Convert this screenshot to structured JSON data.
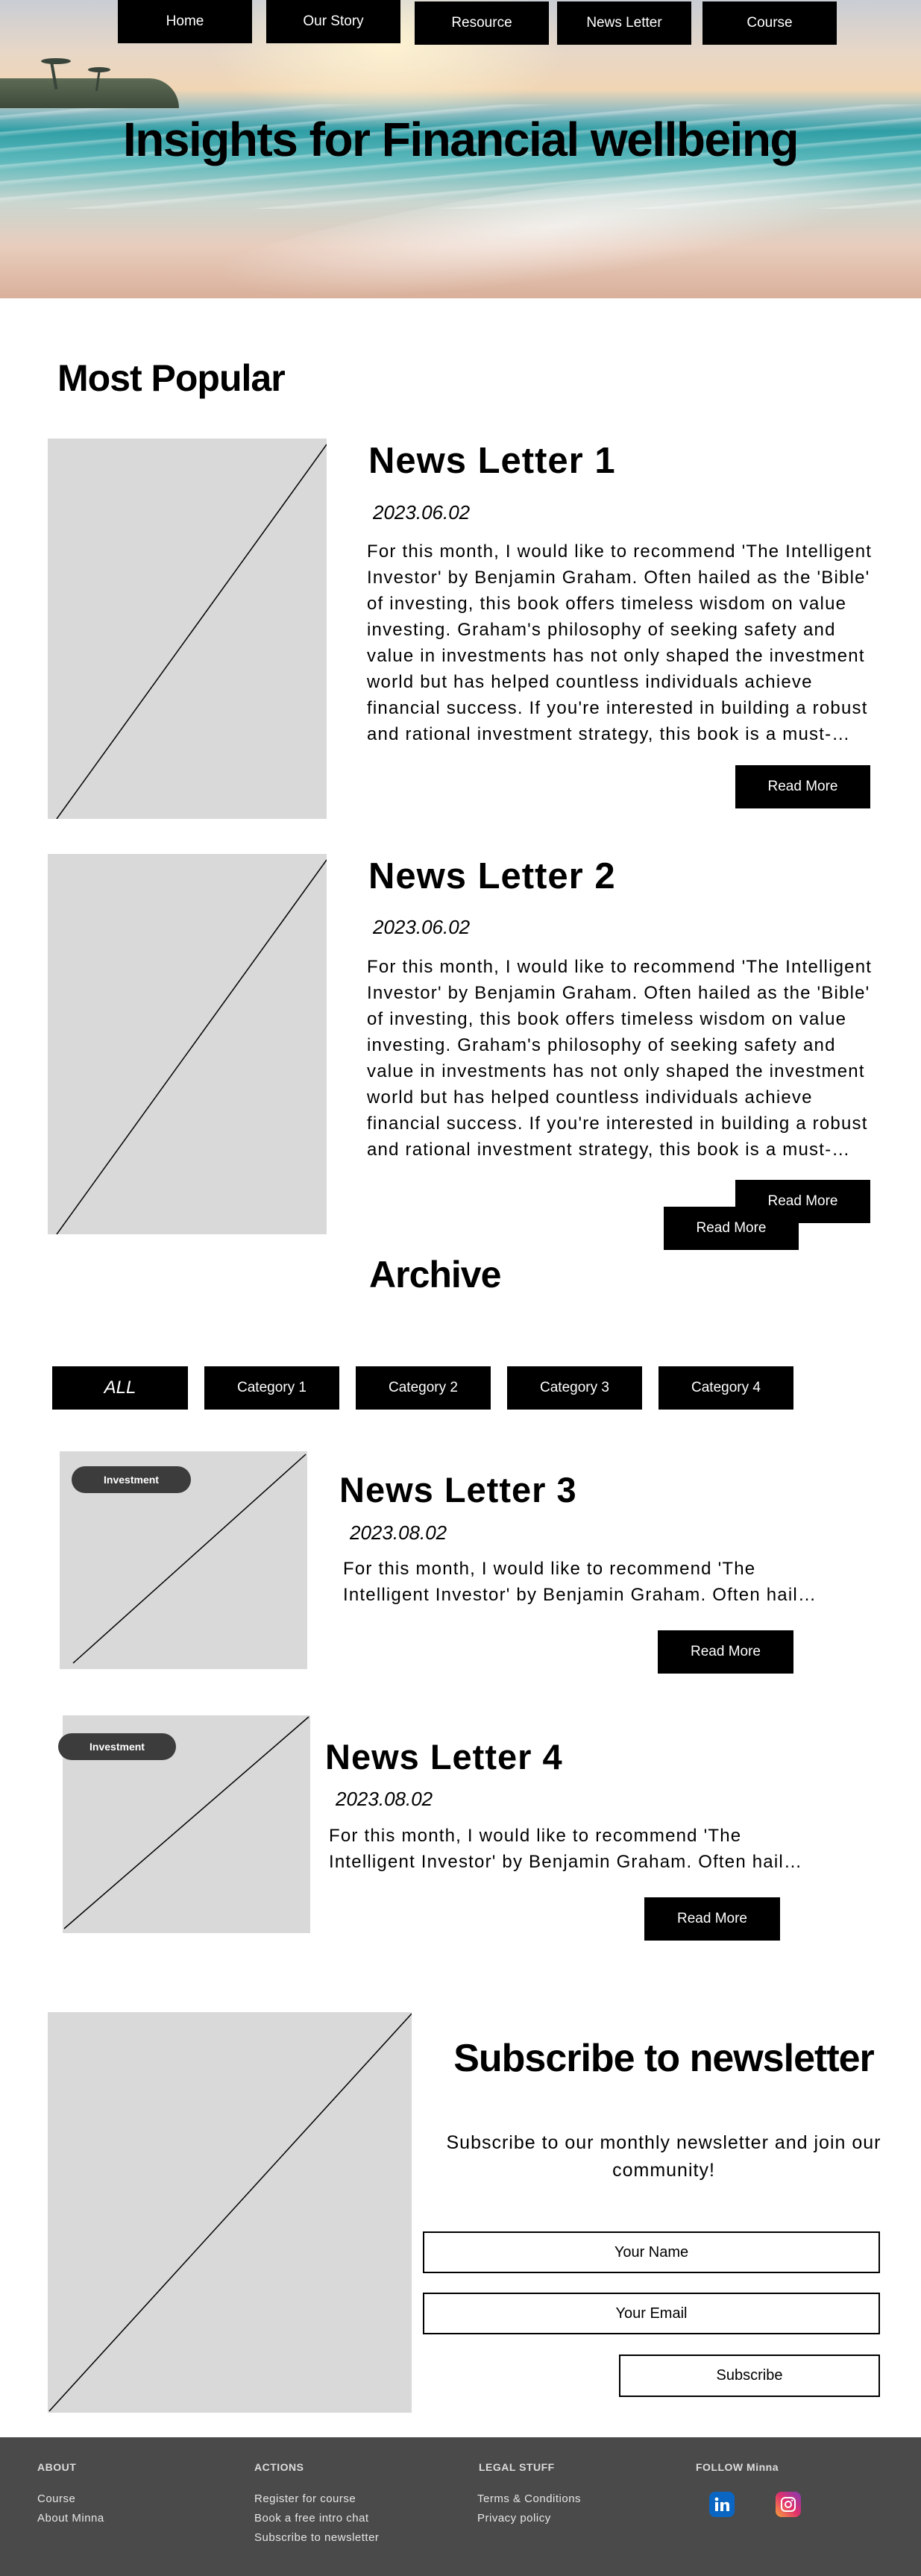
{
  "nav": [
    "Home",
    "Our Story",
    "Resource",
    "News Letter",
    "Course"
  ],
  "hero": {
    "title": "Insights for Financial wellbeing"
  },
  "popular": {
    "heading": "Most  Popular",
    "items": [
      {
        "title": "News Letter  1",
        "date": "2023.06.02",
        "body": "For this month, I would like to recommend 'The Intelligent Investor' by Benjamin Graham. Often hailed as the 'Bible' of investing, this book offers timeless wisdom on value investing. Graham's philosophy of seeking safety and value in investments has not only shaped the investment world but has helped countless individuals achieve financial success. If you're interested in building a robust and rational investment strategy, this book is a must-read.",
        "button": "Read More"
      },
      {
        "title": "News Letter  2",
        "date": "2023.06.02",
        "body": "For this month, I would like to recommend 'The Intelligent Investor' by Benjamin Graham. Often hailed as the 'Bible' of investing, this book offers timeless wisdom on value investing. Graham's philosophy of seeking safety and value in investments has not only shaped the investment world but has helped countless individuals achieve financial success. If you're interested in building a robust and rational investment strategy, this book is a must-read.",
        "button": "Read More",
        "button2": "Read More"
      }
    ]
  },
  "archive": {
    "heading": "Archive",
    "filters": [
      "ALL",
      "Category 1",
      "Category 2",
      "Category 3",
      "Category 4"
    ],
    "items": [
      {
        "tag": "Investment",
        "title": "News Letter  3",
        "date": "2023.08.02",
        "body": "For this month, I would like to recommend 'The Intelligent Investor' by Benjamin Graham. Often hailed as the 'Bible' of investing.",
        "button": "Read More"
      },
      {
        "tag": "Investment",
        "title": "News Letter  4",
        "date": "2023.08.02",
        "body": "For this month, I would like to recommend 'The Intelligent Investor' by Benjamin Graham. Often hailed as the 'Bible' of investing.",
        "button": "Read More"
      }
    ]
  },
  "subscribe": {
    "title": "Subscribe to newsletter",
    "text": "Subscribe to our monthly newsletter and join our community!",
    "name_placeholder": "Your Name",
    "email_placeholder": "Your Email",
    "button": "Subscribe"
  },
  "footer": {
    "about": {
      "heading": "ABOUT",
      "links": [
        "Course",
        "About Minna"
      ]
    },
    "actions": {
      "heading": "ACTIONS",
      "links": [
        "Register for course",
        "Book a free intro chat",
        "Subscribe to newsletter"
      ]
    },
    "legal": {
      "heading": "LEGAL STUFF",
      "links": [
        "Terms & Conditions",
        "Privacy policy"
      ]
    },
    "follow": {
      "heading": "FOLLOW Minna",
      "icons": [
        "linkedin-icon",
        "instagram-icon"
      ]
    }
  }
}
